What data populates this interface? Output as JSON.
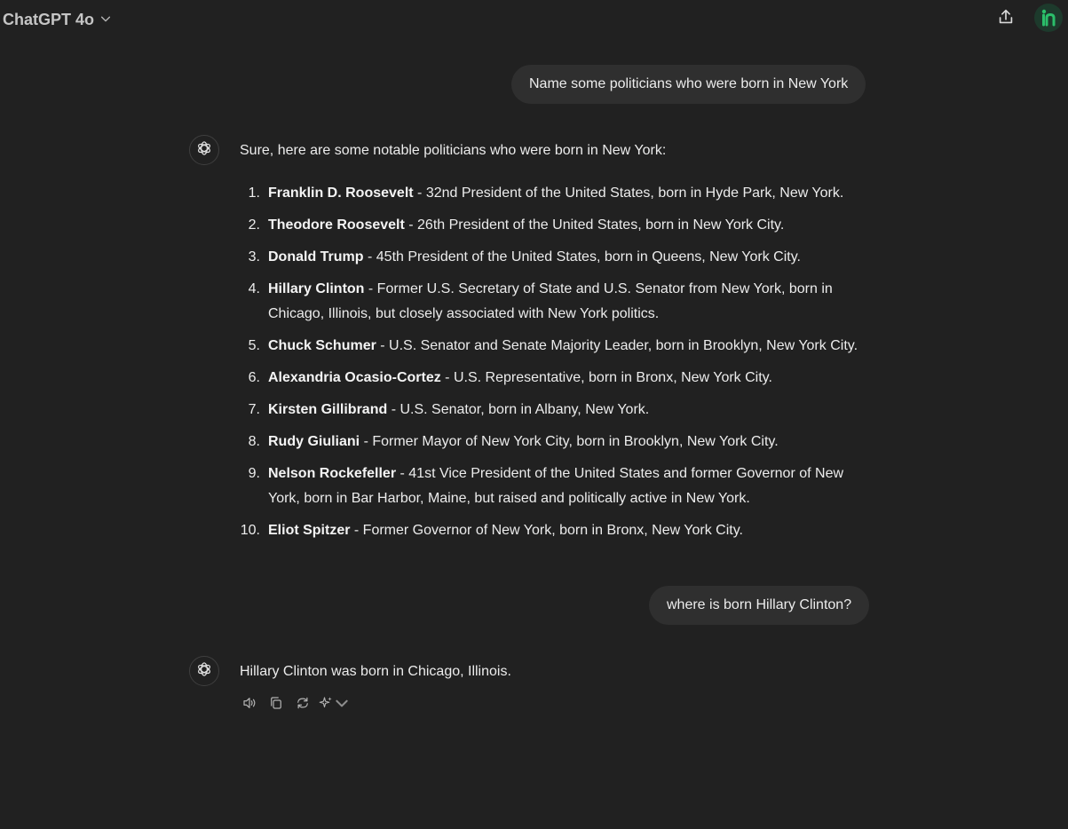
{
  "header": {
    "model_name": "ChatGPT 4o",
    "icons": {
      "model_chevron": "chevron-down-icon",
      "share": "share-icon",
      "avatar": "user-avatar"
    }
  },
  "conversation": {
    "user_message_1": "Name some politicians who were born in New York",
    "assistant_message_1": {
      "intro": "Sure, here are some notable politicians who were born in New York:",
      "items": [
        {
          "num": "1.",
          "name": "Franklin D. Roosevelt",
          "desc": " - 32nd President of the United States, born in Hyde Park, New York."
        },
        {
          "num": "2.",
          "name": "Theodore Roosevelt",
          "desc": " - 26th President of the United States, born in New York City."
        },
        {
          "num": "3.",
          "name": "Donald Trump",
          "desc": " - 45th President of the United States, born in Queens, New York City."
        },
        {
          "num": "4.",
          "name": "Hillary Clinton",
          "desc": " - Former U.S. Secretary of State and U.S. Senator from New York, born in Chicago, Illinois, but closely associated with New York politics."
        },
        {
          "num": "5.",
          "name": "Chuck Schumer",
          "desc": " - U.S. Senator and Senate Majority Leader, born in Brooklyn, New York City."
        },
        {
          "num": "6.",
          "name": "Alexandria Ocasio-Cortez",
          "desc": " - U.S. Representative, born in Bronx, New York City."
        },
        {
          "num": "7.",
          "name": "Kirsten Gillibrand",
          "desc": " - U.S. Senator, born in Albany, New York."
        },
        {
          "num": "8.",
          "name": "Rudy Giuliani",
          "desc": " - Former Mayor of New York City, born in Brooklyn, New York City."
        },
        {
          "num": "9.",
          "name": "Nelson Rockefeller",
          "desc": " - 41st Vice President of the United States and former Governor of New York, born in Bar Harbor, Maine, but raised and politically active in New York."
        },
        {
          "num": "10.",
          "name": "Eliot Spitzer",
          "desc": " - Former Governor of New York, born in Bronx, New York City."
        }
      ]
    },
    "user_message_2": "where is born Hillary Clinton?",
    "assistant_message_2": "Hillary Clinton was born in Chicago, Illinois.",
    "message_actions": [
      "read-aloud-icon",
      "copy-icon",
      "regenerate-icon",
      "sparkle-icon"
    ]
  },
  "colors": {
    "background": "#212121",
    "bubble": "#2f2f2f",
    "text": "#ececec",
    "avatar_accent": "#2bbf6a"
  }
}
